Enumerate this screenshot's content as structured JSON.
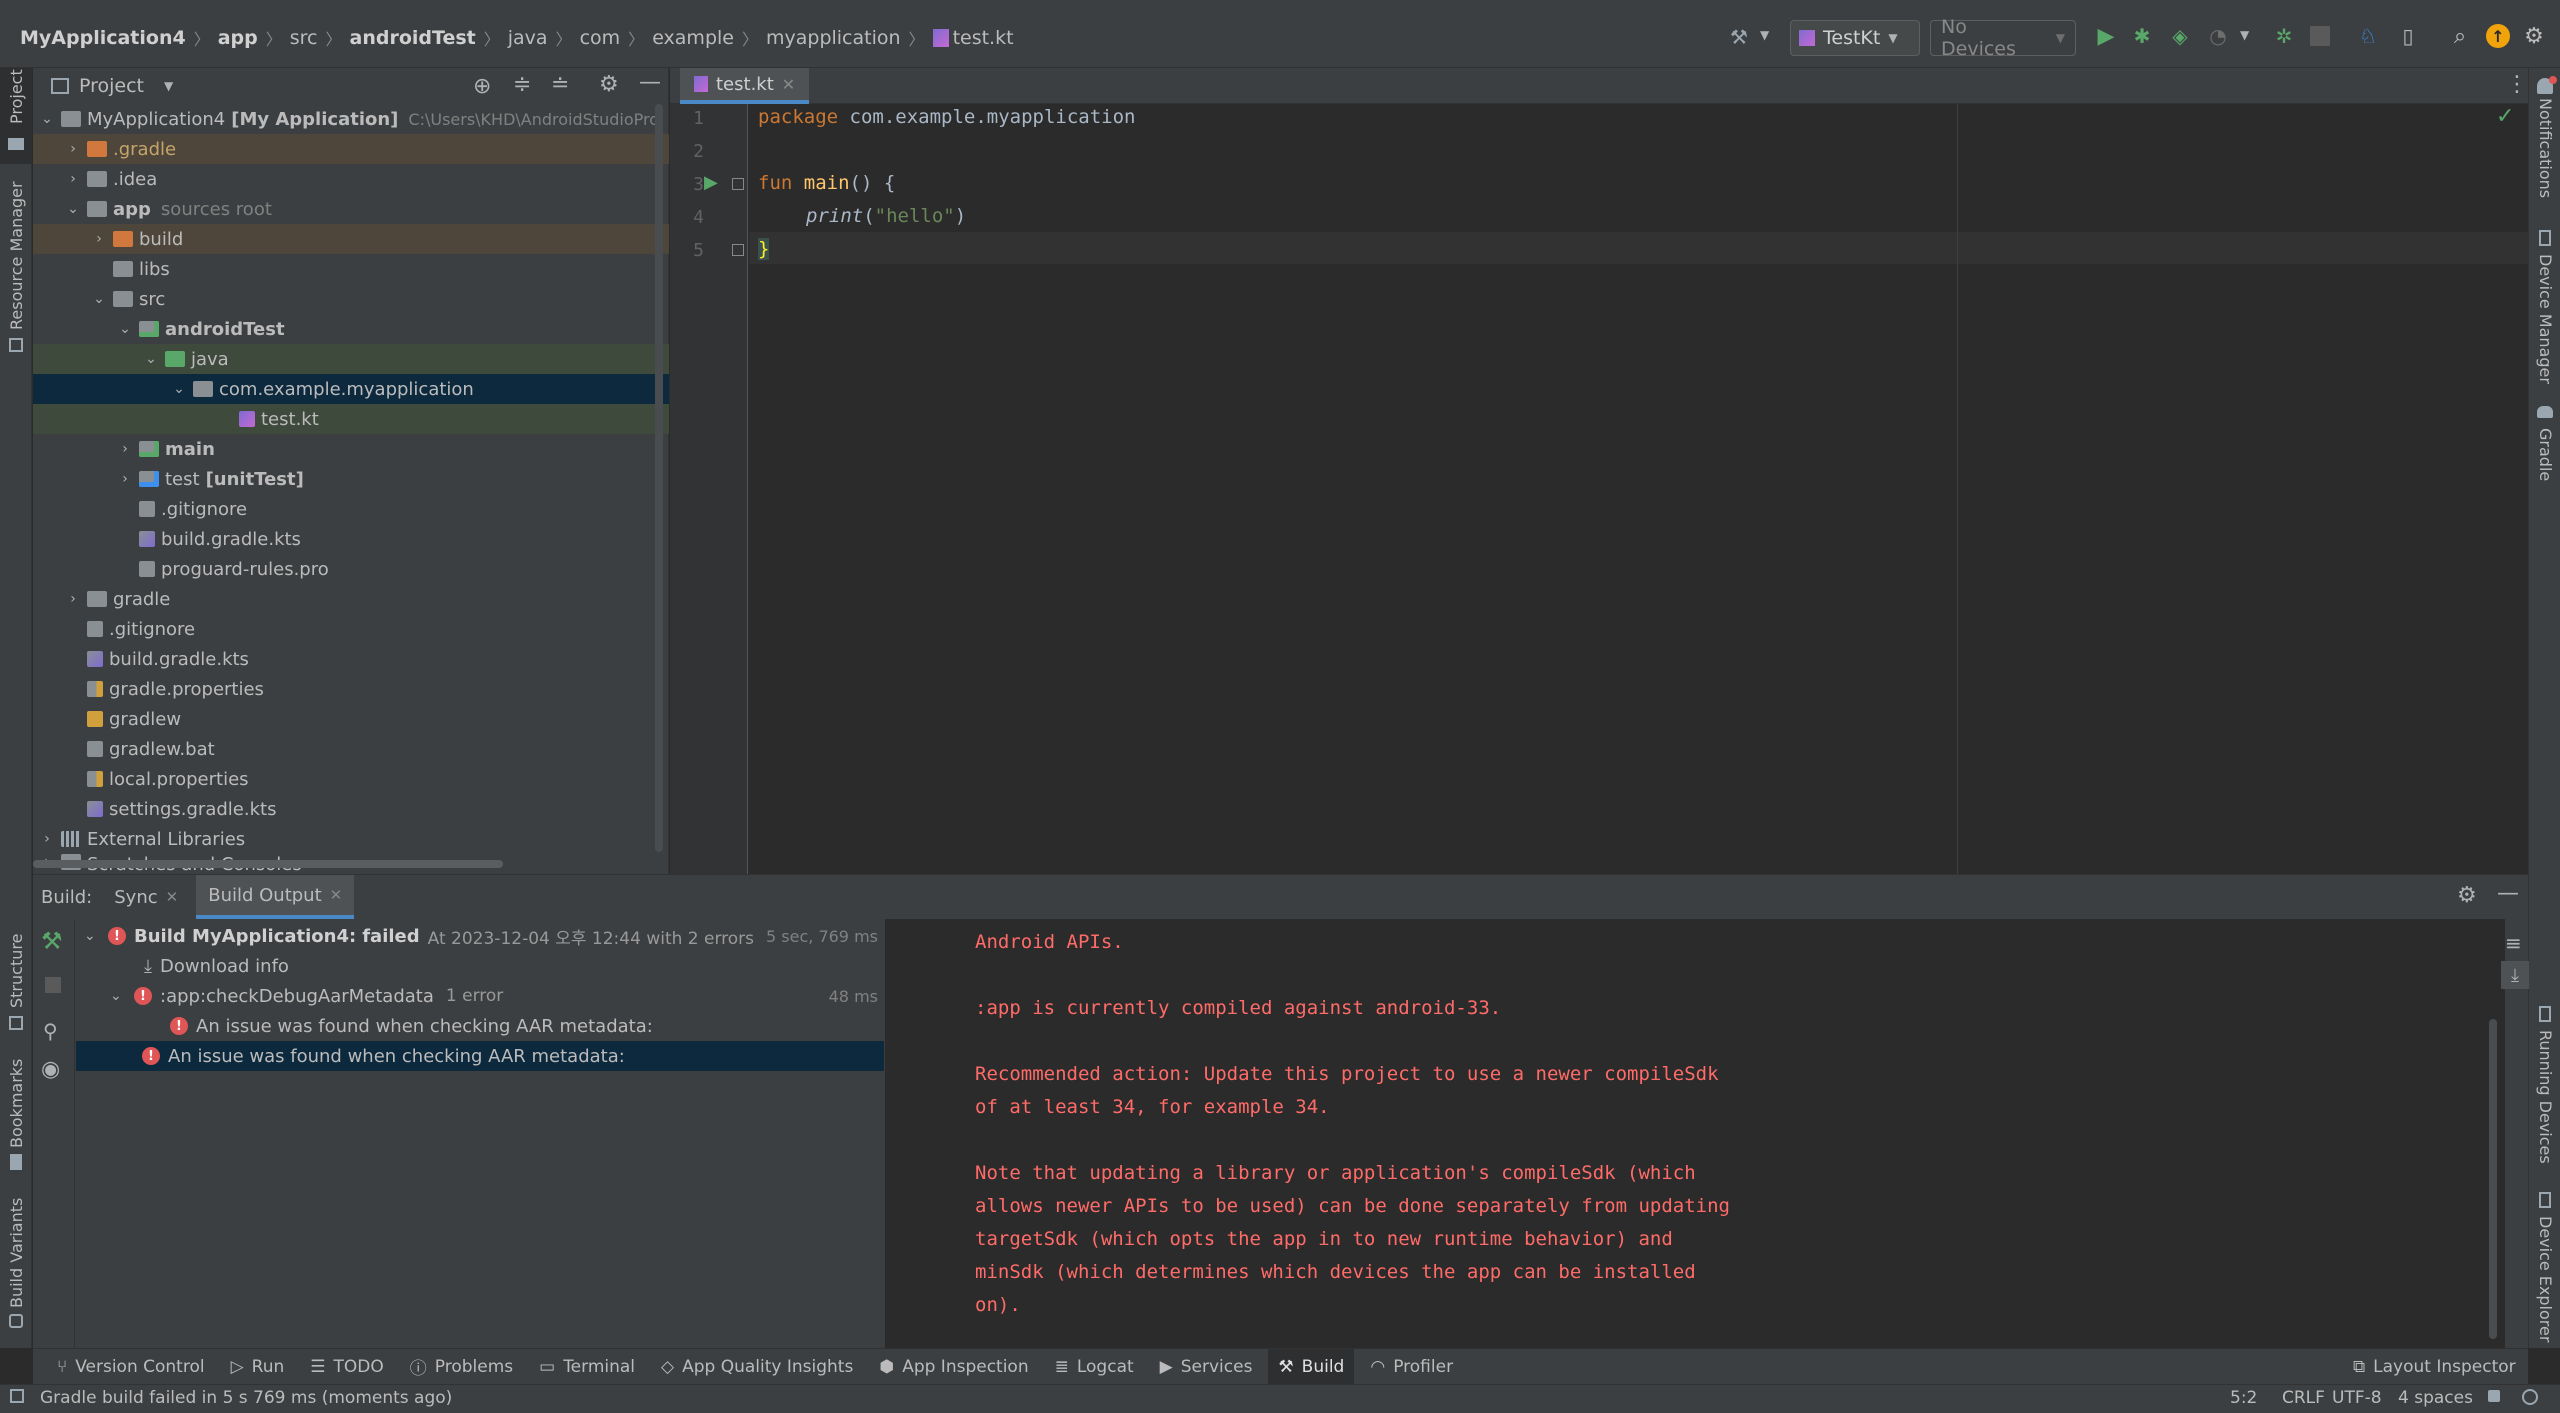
{
  "breadcrumb": [
    "MyApplication4",
    "app",
    "src",
    "androidTest",
    "java",
    "com",
    "example",
    "myapplication",
    "test.kt"
  ],
  "toolbar": {
    "run_config": "TestKt",
    "devices": "No Devices"
  },
  "left_strip": {
    "project": "Project",
    "resource_manager": "Resource Manager",
    "structure": "Structure",
    "bookmarks": "Bookmarks",
    "build_variants": "Build Variants"
  },
  "right_strip": {
    "notifications": "Notifications",
    "device_manager": "Device Manager",
    "gradle": "Gradle",
    "running_devices": "Running Devices",
    "device_explorer": "Device Explorer"
  },
  "project": {
    "title": "Project",
    "root_name": "MyApplication4",
    "root_module": "[My Application]",
    "root_path": "C:\\Users\\KHD\\AndroidStudioPro",
    "items": [
      {
        "label": ".gradle",
        "hint": ""
      },
      {
        "label": ".idea",
        "hint": ""
      },
      {
        "label": "app",
        "hint": "sources root"
      },
      {
        "label": "build",
        "hint": ""
      },
      {
        "label": "libs",
        "hint": ""
      },
      {
        "label": "src",
        "hint": ""
      },
      {
        "label": "androidTest",
        "hint": ""
      },
      {
        "label": "java",
        "hint": ""
      },
      {
        "label": "com.example.myapplication",
        "hint": ""
      },
      {
        "label": "test.kt",
        "hint": ""
      },
      {
        "label": "main",
        "hint": ""
      },
      {
        "label": "test",
        "hint": "[unitTest]"
      },
      {
        "label": ".gitignore",
        "hint": ""
      },
      {
        "label": "build.gradle.kts",
        "hint": ""
      },
      {
        "label": "proguard-rules.pro",
        "hint": ""
      },
      {
        "label": "gradle",
        "hint": ""
      },
      {
        "label": ".gitignore",
        "hint": ""
      },
      {
        "label": "build.gradle.kts",
        "hint": ""
      },
      {
        "label": "gradle.properties",
        "hint": ""
      },
      {
        "label": "gradlew",
        "hint": ""
      },
      {
        "label": "gradlew.bat",
        "hint": ""
      },
      {
        "label": "local.properties",
        "hint": ""
      },
      {
        "label": "settings.gradle.kts",
        "hint": ""
      },
      {
        "label": "External Libraries",
        "hint": ""
      },
      {
        "label": "Scratches and Consoles",
        "hint": ""
      }
    ]
  },
  "editor": {
    "tab": "test.kt",
    "line_numbers": [
      "1",
      "2",
      "3",
      "4",
      "5"
    ],
    "code": {
      "l1_kw": "package",
      "l1_rest": " com.example.myapplication",
      "l3_kw": "fun",
      "l3_fn": " main",
      "l3_rest": "() {",
      "l4_fn": "print",
      "l4_open": "(",
      "l4_str": "\"hello\"",
      "l4_close": ")",
      "l5": "}"
    }
  },
  "build": {
    "label": "Build:",
    "tabs": [
      "Sync",
      "Build Output"
    ],
    "tree": {
      "root_title": "Build MyApplication4:",
      "root_status": "failed",
      "root_detail": "At 2023-12-04 오후 12:44 with 2 errors",
      "root_time": "5 sec, 769 ms",
      "download": "Download info",
      "task": ":app:checkDebugAarMetadata",
      "task_count": "1 error",
      "task_time": "48 ms",
      "issue1": "An issue was found when checking AAR metadata:",
      "issue2": "An issue was found when checking AAR metadata:"
    },
    "console_lines": [
      "Android APIs.",
      "",
      ":app is currently compiled against android-33.",
      "",
      "Recommended action: Update this project to use a newer compileSdk",
      "of at least 34, for example 34.",
      "",
      "Note that updating a library or application's compileSdk (which",
      "allows newer APIs to be used) can be done separately from updating",
      "targetSdk (which opts the app in to new runtime behavior) and",
      "minSdk (which determines which devices the app can be installed",
      "on)."
    ]
  },
  "bottom_tabs": [
    "Version Control",
    "Run",
    "TODO",
    "Problems",
    "Terminal",
    "App Quality Insights",
    "App Inspection",
    "Logcat",
    "Services",
    "Build",
    "Profiler"
  ],
  "layout_inspector": "Layout Inspector",
  "status": {
    "message": "Gradle build failed in 5 s 769 ms (moments ago)",
    "position": "5:2",
    "line_sep": "CRLF",
    "encoding": "UTF-8",
    "indent": "4 spaces"
  },
  "colors": {
    "accent": "#4a88c7",
    "error": "#e05555",
    "console_error": "#ff6b68",
    "run_green": "#59a869"
  }
}
